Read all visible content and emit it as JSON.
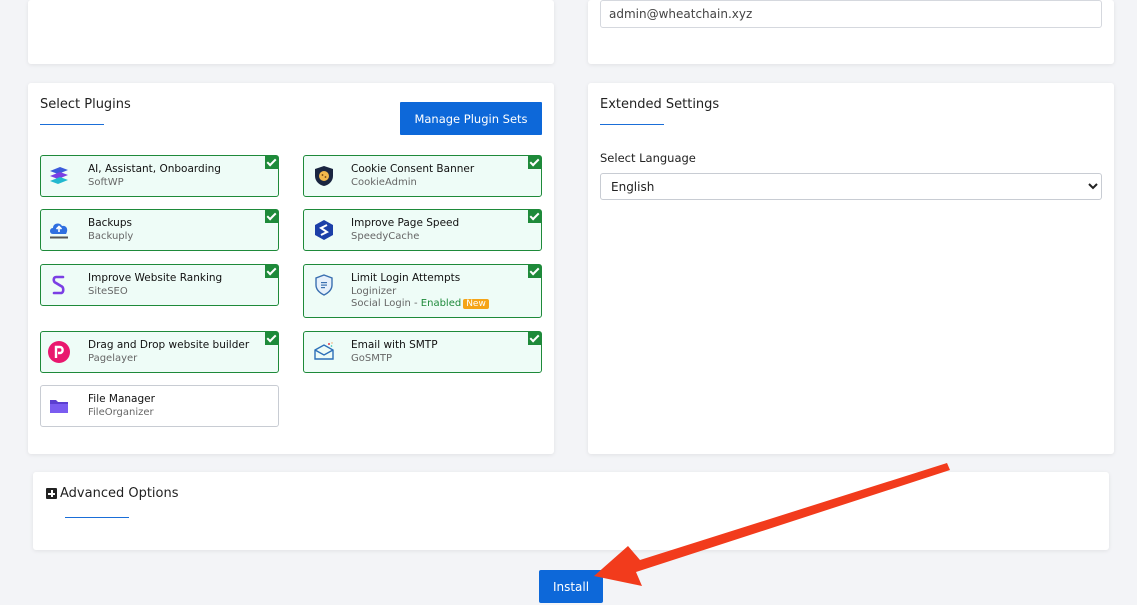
{
  "admin_email": {
    "value": "admin@wheatchain.xyz"
  },
  "plugins_section": {
    "title": "Select Plugins",
    "manage_button": "Manage Plugin Sets",
    "plugins": [
      {
        "name": "AI, Assistant, Onboarding",
        "by": "SoftWP",
        "checked": true,
        "icon": "softwp-icon"
      },
      {
        "name": "Cookie Consent Banner",
        "by": "CookieAdmin",
        "checked": true,
        "icon": "cookie-icon"
      },
      {
        "name": "Backups",
        "by": "Backuply",
        "checked": true,
        "icon": "backup-cloud-icon"
      },
      {
        "name": "Improve Page Speed",
        "by": "SpeedyCache",
        "checked": true,
        "icon": "speedycache-icon"
      },
      {
        "name": "Improve Website Ranking",
        "by": "SiteSEO",
        "checked": true,
        "icon": "siteseo-icon"
      },
      {
        "name": "Limit Login Attempts",
        "by": "Loginizer",
        "extra": "Social Login - ",
        "extra_status": "Enabled",
        "badge": "New",
        "checked": true,
        "icon": "shield-icon"
      },
      {
        "name": "Drag and Drop website builder",
        "by": "Pagelayer",
        "checked": true,
        "icon": "pagelayer-icon"
      },
      {
        "name": "Email with SMTP",
        "by": "GoSMTP",
        "checked": true,
        "icon": "email-icon"
      },
      {
        "name": "File Manager",
        "by": "FileOrganizer",
        "checked": false,
        "icon": "folder-icon"
      }
    ]
  },
  "extended_settings": {
    "title": "Extended Settings",
    "language_label": "Select Language",
    "language_value": "English"
  },
  "advanced_options": {
    "title": "Advanced Options"
  },
  "install_button": "Install",
  "colors": {
    "primary": "#0d68d9",
    "checked_border": "#1e8a3a",
    "checked_bg": "#eefcf7",
    "arrow": "#f23b1c"
  }
}
